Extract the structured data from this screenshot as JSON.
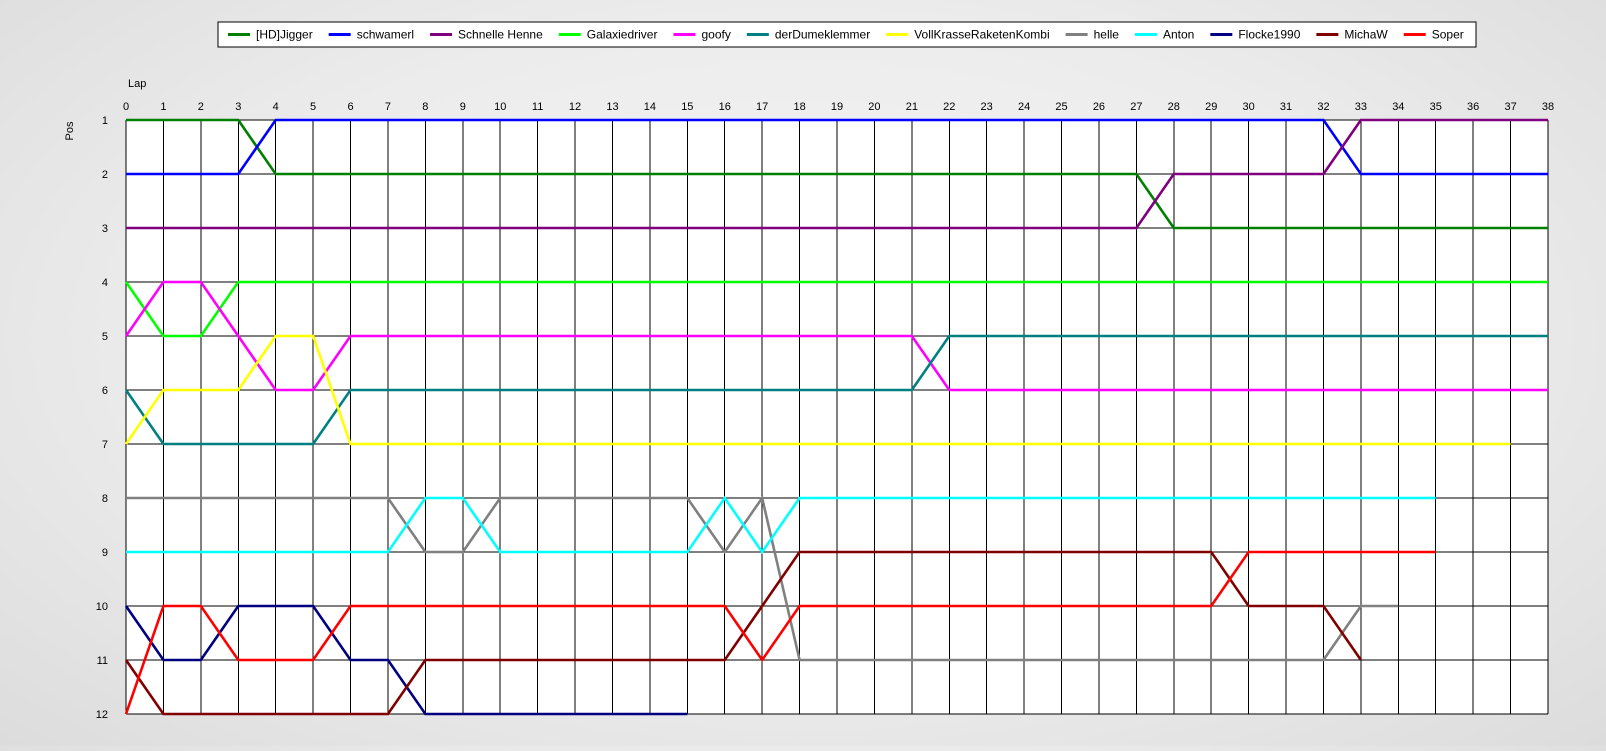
{
  "chart_data": {
    "type": "line",
    "xlabel": "Lap",
    "ylabel": "Pos",
    "xlim": [
      0,
      38
    ],
    "ylim": [
      1,
      12
    ],
    "y_reversed": true,
    "grid": true,
    "legend_position": "top",
    "x_ticks": [
      "0",
      "1",
      "2",
      "3",
      "4",
      "5",
      "6",
      "7",
      "8",
      "9",
      "10",
      "11",
      "12",
      "13",
      "14",
      "15",
      "16",
      "17",
      "18",
      "19",
      "20",
      "21",
      "22",
      "23",
      "24",
      "25",
      "26",
      "27",
      "28",
      "29",
      "30",
      "31",
      "32",
      "33",
      "34",
      "35",
      "36",
      "37",
      "38"
    ],
    "y_ticks": [
      "1",
      "2",
      "3",
      "4",
      "5",
      "6",
      "7",
      "8",
      "9",
      "10",
      "11",
      "12"
    ],
    "series": [
      {
        "name": "[HD]Jigger",
        "color": "#008000",
        "x": [
          0,
          1,
          2,
          3,
          4,
          5,
          6,
          7,
          8,
          9,
          10,
          11,
          12,
          13,
          14,
          15,
          16,
          17,
          18,
          19,
          20,
          21,
          22,
          23,
          24,
          25,
          26,
          27,
          28,
          29,
          30,
          31,
          32,
          33,
          34,
          35,
          36,
          37,
          38
        ],
        "y": [
          1,
          1,
          1,
          1,
          2,
          2,
          2,
          2,
          2,
          2,
          2,
          2,
          2,
          2,
          2,
          2,
          2,
          2,
          2,
          2,
          2,
          2,
          2,
          2,
          2,
          2,
          2,
          2,
          3,
          3,
          3,
          3,
          3,
          3,
          3,
          3,
          3,
          3,
          3
        ]
      },
      {
        "name": "schwamerl",
        "color": "#0000ff",
        "x": [
          0,
          1,
          2,
          3,
          4,
          5,
          6,
          7,
          8,
          9,
          10,
          11,
          12,
          13,
          14,
          15,
          16,
          17,
          18,
          19,
          20,
          21,
          22,
          23,
          24,
          25,
          26,
          27,
          28,
          29,
          30,
          31,
          32,
          33,
          34,
          35,
          36,
          37,
          38
        ],
        "y": [
          2,
          2,
          2,
          2,
          1,
          1,
          1,
          1,
          1,
          1,
          1,
          1,
          1,
          1,
          1,
          1,
          1,
          1,
          1,
          1,
          1,
          1,
          1,
          1,
          1,
          1,
          1,
          1,
          1,
          1,
          1,
          1,
          1,
          2,
          2,
          2,
          2,
          2,
          2
        ]
      },
      {
        "name": "Schnelle Henne",
        "color": "#800080",
        "x": [
          0,
          1,
          2,
          3,
          4,
          5,
          6,
          7,
          8,
          9,
          10,
          11,
          12,
          13,
          14,
          15,
          16,
          17,
          18,
          19,
          20,
          21,
          22,
          23,
          24,
          25,
          26,
          27,
          28,
          29,
          30,
          31,
          32,
          33,
          34,
          35,
          36,
          37,
          38
        ],
        "y": [
          3,
          3,
          3,
          3,
          3,
          3,
          3,
          3,
          3,
          3,
          3,
          3,
          3,
          3,
          3,
          3,
          3,
          3,
          3,
          3,
          3,
          3,
          3,
          3,
          3,
          3,
          3,
          3,
          2,
          2,
          2,
          2,
          2,
          1,
          1,
          1,
          1,
          1,
          1
        ]
      },
      {
        "name": "Galaxiedriver",
        "color": "#00ff00",
        "x": [
          0,
          1,
          2,
          3,
          4,
          5,
          6,
          7,
          8,
          9,
          10,
          11,
          12,
          13,
          14,
          15,
          16,
          17,
          18,
          19,
          20,
          21,
          22,
          23,
          24,
          25,
          26,
          27,
          28,
          29,
          30,
          31,
          32,
          33,
          34,
          35,
          36,
          37,
          38
        ],
        "y": [
          4,
          5,
          5,
          4,
          4,
          4,
          4,
          4,
          4,
          4,
          4,
          4,
          4,
          4,
          4,
          4,
          4,
          4,
          4,
          4,
          4,
          4,
          4,
          4,
          4,
          4,
          4,
          4,
          4,
          4,
          4,
          4,
          4,
          4,
          4,
          4,
          4,
          4,
          4
        ]
      },
      {
        "name": "goofy",
        "color": "#ff00ff",
        "x": [
          0,
          1,
          2,
          3,
          4,
          5,
          6,
          7,
          8,
          9,
          10,
          11,
          12,
          13,
          14,
          15,
          16,
          17,
          18,
          19,
          20,
          21,
          22,
          23,
          24,
          25,
          26,
          27,
          28,
          29,
          30,
          31,
          32,
          33,
          34,
          35,
          36,
          37,
          38
        ],
        "y": [
          5,
          4,
          4,
          5,
          6,
          6,
          5,
          5,
          5,
          5,
          5,
          5,
          5,
          5,
          5,
          5,
          5,
          5,
          5,
          5,
          5,
          5,
          6,
          6,
          6,
          6,
          6,
          6,
          6,
          6,
          6,
          6,
          6,
          6,
          6,
          6,
          6,
          6,
          6
        ]
      },
      {
        "name": "derDumeklemmer",
        "color": "#008080",
        "x": [
          0,
          1,
          2,
          3,
          4,
          5,
          6,
          7,
          8,
          9,
          10,
          11,
          12,
          13,
          14,
          15,
          16,
          17,
          18,
          19,
          20,
          21,
          22,
          23,
          24,
          25,
          26,
          27,
          28,
          29,
          30,
          31,
          32,
          33,
          34,
          35,
          36,
          37,
          38
        ],
        "y": [
          6,
          7,
          7,
          7,
          7,
          7,
          6,
          6,
          6,
          6,
          6,
          6,
          6,
          6,
          6,
          6,
          6,
          6,
          6,
          6,
          6,
          6,
          5,
          5,
          5,
          5,
          5,
          5,
          5,
          5,
          5,
          5,
          5,
          5,
          5,
          5,
          5,
          5,
          5
        ]
      },
      {
        "name": "VollKrasseRaketenKombi",
        "color": "#ffff00",
        "x": [
          0,
          1,
          2,
          3,
          4,
          5,
          6,
          7,
          8,
          9,
          10,
          11,
          12,
          13,
          14,
          15,
          16,
          17,
          18,
          19,
          20,
          21,
          22,
          23,
          24,
          25,
          26,
          27,
          28,
          29,
          30,
          31,
          32,
          33,
          34,
          35,
          36,
          37
        ],
        "y": [
          7,
          6,
          6,
          6,
          5,
          5,
          7,
          7,
          7,
          7,
          7,
          7,
          7,
          7,
          7,
          7,
          7,
          7,
          7,
          7,
          7,
          7,
          7,
          7,
          7,
          7,
          7,
          7,
          7,
          7,
          7,
          7,
          7,
          7,
          7,
          7,
          7,
          7
        ]
      },
      {
        "name": "helle",
        "color": "#808080",
        "x": [
          0,
          1,
          2,
          3,
          4,
          5,
          6,
          7,
          8,
          9,
          10,
          11,
          12,
          13,
          14,
          15,
          16,
          17,
          18,
          19,
          20,
          21,
          22,
          23,
          24,
          25,
          26,
          27,
          28,
          29,
          30,
          31,
          32,
          33,
          34
        ],
        "y": [
          8,
          8,
          8,
          8,
          8,
          8,
          8,
          8,
          9,
          9,
          8,
          8,
          8,
          8,
          8,
          8,
          9,
          8,
          11,
          11,
          11,
          11,
          11,
          11,
          11,
          11,
          11,
          11,
          11,
          11,
          11,
          11,
          11,
          10,
          10
        ]
      },
      {
        "name": "Anton",
        "color": "#00ffff",
        "x": [
          0,
          1,
          2,
          3,
          4,
          5,
          6,
          7,
          8,
          9,
          10,
          11,
          12,
          13,
          14,
          15,
          16,
          17,
          18,
          19,
          20,
          21,
          22,
          23,
          24,
          25,
          26,
          27,
          28,
          29,
          30,
          31,
          32,
          33,
          34,
          35
        ],
        "y": [
          9,
          9,
          9,
          9,
          9,
          9,
          9,
          9,
          8,
          8,
          9,
          9,
          9,
          9,
          9,
          9,
          8,
          9,
          8,
          8,
          8,
          8,
          8,
          8,
          8,
          8,
          8,
          8,
          8,
          8,
          8,
          8,
          8,
          8,
          8,
          8
        ]
      },
      {
        "name": "Flocke1990",
        "color": "#000080",
        "x": [
          0,
          1,
          2,
          3,
          4,
          5,
          6,
          7,
          8,
          9,
          10,
          11,
          12,
          13,
          14,
          15
        ],
        "y": [
          10,
          11,
          11,
          10,
          10,
          10,
          11,
          11,
          12,
          12,
          12,
          12,
          12,
          12,
          12,
          12
        ]
      },
      {
        "name": "MichaW",
        "color": "#800000",
        "x": [
          0,
          1,
          2,
          3,
          4,
          5,
          6,
          7,
          8,
          9,
          10,
          11,
          12,
          13,
          14,
          15,
          16,
          17,
          18,
          19,
          20,
          21,
          22,
          23,
          24,
          25,
          26,
          27,
          28,
          29,
          30,
          31,
          32,
          33
        ],
        "y": [
          11,
          12,
          12,
          12,
          12,
          12,
          12,
          12,
          11,
          11,
          11,
          11,
          11,
          11,
          11,
          11,
          11,
          10,
          9,
          9,
          9,
          9,
          9,
          9,
          9,
          9,
          9,
          9,
          9,
          9,
          10,
          10,
          10,
          11
        ]
      },
      {
        "name": "Soper",
        "color": "#ff0000",
        "x": [
          0,
          1,
          2,
          3,
          4,
          5,
          6,
          7,
          8,
          9,
          10,
          11,
          12,
          13,
          14,
          15,
          16,
          17,
          18,
          19,
          20,
          21,
          22,
          23,
          24,
          25,
          26,
          27,
          28,
          29,
          30,
          31,
          32,
          33,
          34,
          35
        ],
        "y": [
          12,
          10,
          10,
          11,
          11,
          11,
          10,
          10,
          10,
          10,
          10,
          10,
          10,
          10,
          10,
          10,
          10,
          11,
          10,
          10,
          10,
          10,
          10,
          10,
          10,
          10,
          10,
          10,
          10,
          10,
          9,
          9,
          9,
          9,
          9,
          9
        ]
      }
    ]
  }
}
